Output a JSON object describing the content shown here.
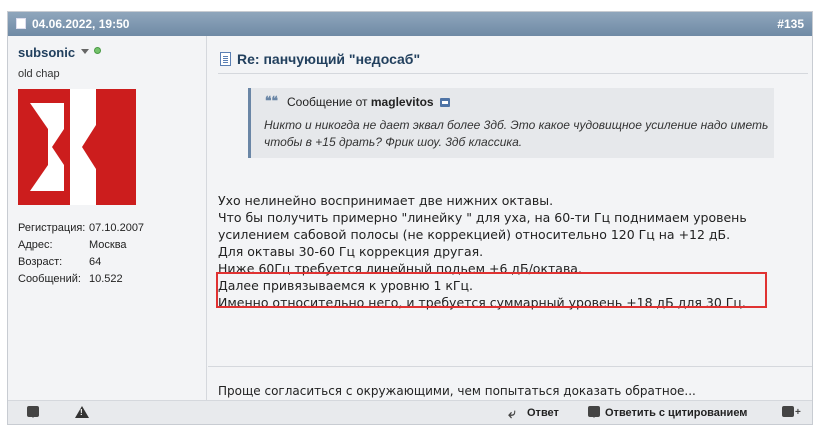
{
  "header": {
    "date": "04.06.2022, 19:50",
    "post_number": "#135"
  },
  "user": {
    "name": "subsonic",
    "title": "old chap",
    "avatar_colors": {
      "primary": "#cc1d1d",
      "secondary": "#ffffff"
    },
    "stats": [
      {
        "label": "Регистрация:",
        "value": "07.10.2007"
      },
      {
        "label": "Адрес:",
        "value": "Москва"
      },
      {
        "label": "Возраст:",
        "value": "64"
      },
      {
        "label": "Сообщений:",
        "value": "10.522"
      }
    ]
  },
  "post": {
    "title": "Re: панчующий \"недосаб\"",
    "quote": {
      "prefix": "Сообщение от",
      "author": "maglevitos",
      "text": "Никто и никогда не дает эквал более 3дб. Это какое чудовищное усиление надо иметь чтобы в +15 драть? Фрик шоу. 3дб классика."
    },
    "lines": [
      "Ухо нелинейно воспринимает две нижних октавы.",
      "Что бы получить примерно \"линейку \" для уха, на 60-ти Гц поднимаем уровень",
      "усилением сабовой полосы (не коррекцией) относительно 120 Гц на +12 дБ.",
      "Для октавы 30-60 Гц коррекция другая.",
      "Ниже 60Гц требуется линейный подьем +6 дБ/октава.",
      "Далее привязываемся к уровню 1 кГц.",
      "Именно относительно него, и требуется суммарный уровень +18 дБ для 30 Гц."
    ],
    "signature": "Проще согласиться с окружающими, чем попытаться доказать обратное..."
  },
  "footer": {
    "reply_label": "Ответ",
    "quote_label": "Ответить с цитированием"
  },
  "colors": {
    "header_bg": "#7f98b2",
    "link": "#22405e",
    "highlight": "#e03232"
  }
}
